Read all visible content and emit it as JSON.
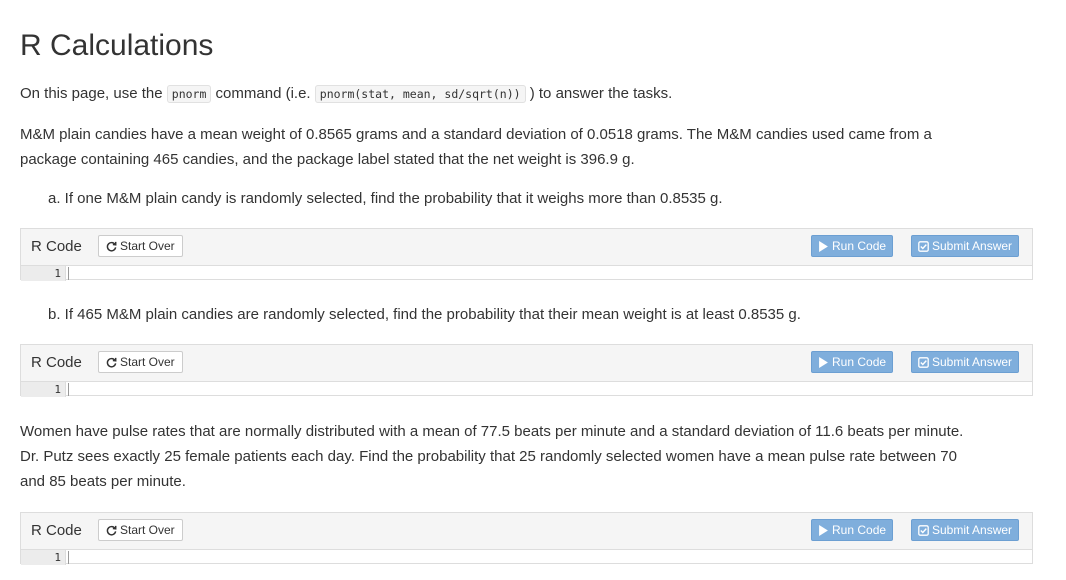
{
  "title": "R Calculations",
  "intro": {
    "before": "On this page, use the ",
    "code1": "pnorm",
    "middle": " command (i.e. ",
    "code2": "pnorm(stat, mean, sd/sqrt(n))",
    "after": " ) to answer the tasks."
  },
  "mm_paragraph_line1": "M&M plain candies have a mean weight of 0.8565 grams and a standard deviation of 0.0518 grams. The M&M candies used came from a",
  "mm_paragraph_line2": "package containing 465 candies, and the package label stated that the net weight is 396.9 g.",
  "question_a": "a. If one M&M plain candy is randomly selected, find the probability that it weighs more than 0.8535 g.",
  "question_b": "b. If 465 M&M plain candies are randomly selected, find the probability that their mean weight is at least 0.8535 g.",
  "pulse_line1": "Women have pulse rates that are normally distributed with a mean of 77.5 beats per minute and a standard deviation of 11.6 beats per minute.",
  "pulse_line2": "Dr. Putz sees exactly 25 female patients each day. Find the probability that 25 randomly selected women have a mean pulse rate between 70",
  "pulse_line3": "and 85 beats per minute.",
  "exercise": {
    "label": "R Code",
    "start_over": "Start Over",
    "run_code": "Run Code",
    "submit_answer": "Submit Answer",
    "line_number": "1"
  },
  "icons": {
    "start_over": "refresh-icon",
    "run": "play-icon",
    "submit": "check-square-icon"
  },
  "colors": {
    "button_blue": "#7faedc",
    "text": "#333333"
  }
}
